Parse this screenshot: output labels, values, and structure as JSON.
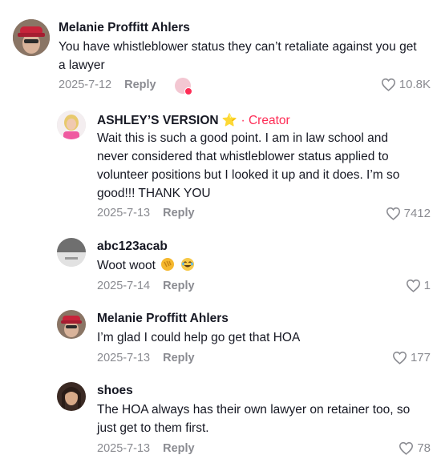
{
  "comments": [
    {
      "author": "Melanie Proffitt Ahlers",
      "text": "You have whistleblower status they can’t retaliate against you get a lawyer",
      "date": "2025-7-12",
      "reply_label": "Reply",
      "likes": "10.8K"
    },
    {
      "author": "ASHLEY’S VERSION ⭐",
      "creator_tag": "· Creator",
      "text": "Wait this is such a good point. I am in law school and never considered that whistleblower status applied to volunteer positions but I looked it up and it does. I’m so good!!! THANK YOU",
      "date": "2025-7-13",
      "reply_label": "Reply",
      "likes": "7412"
    },
    {
      "author": "abc123acab",
      "text": "Woot woot",
      "date": "2025-7-14",
      "reply_label": "Reply",
      "likes": "1"
    },
    {
      "author": "Melanie Proffitt Ahlers",
      "text": "I’m glad I could help go get that HOA",
      "date": "2025-7-13",
      "reply_label": "Reply",
      "likes": "177"
    },
    {
      "author": "shoes",
      "text": "The HOA always has their own lawyer on retainer too, so just get to them first.",
      "date": "2025-7-13",
      "reply_label": "Reply",
      "likes": "78"
    }
  ],
  "colors": {
    "creator": "#fe2c55",
    "meta": "#8a8b91",
    "text": "#161823"
  },
  "icons": [
    "heart-outline-icon",
    "clapping-hands-emoji",
    "laughing-emoji"
  ]
}
